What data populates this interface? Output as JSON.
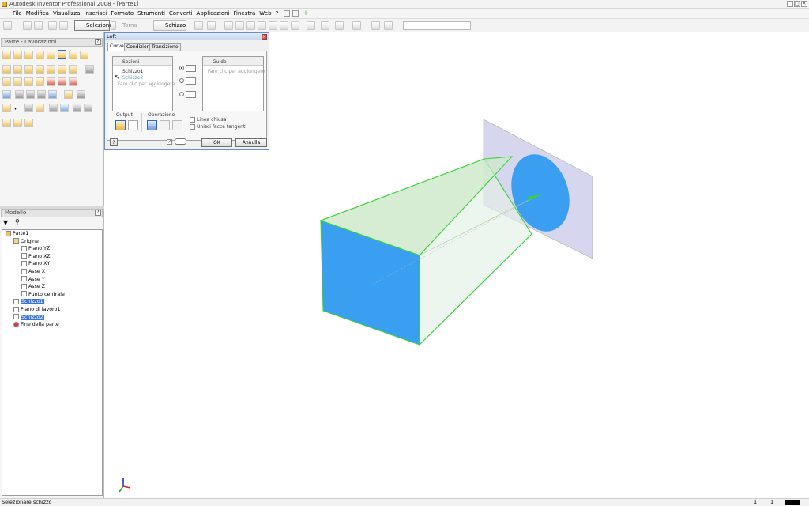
{
  "window": {
    "title": "Autodesk Inventor Professional 2008 - [Parte1]"
  },
  "menu": [
    "File",
    "Modifica",
    "Visualizza",
    "Inserisci",
    "Formato",
    "Strumenti",
    "Converti",
    "Applicazioni",
    "Finestra",
    "Web",
    "?"
  ],
  "toolbar": {
    "select_label": "Seleziona",
    "ritorna_label": "Torna",
    "sketch_label": "Schizzo"
  },
  "panel": {
    "title": "Parte - Lavorazioni"
  },
  "browser": {
    "title": "Modello",
    "tree": [
      {
        "label": "Parte1",
        "icon": "part-icon",
        "level": 0
      },
      {
        "label": "Origine",
        "icon": "folder-icon",
        "level": 1
      },
      {
        "label": "Piano YZ",
        "icon": "plane-icon",
        "level": 2
      },
      {
        "label": "Piano XZ",
        "icon": "plane-icon",
        "level": 2
      },
      {
        "label": "Piano XY",
        "icon": "plane-icon",
        "level": 2
      },
      {
        "label": "Asse X",
        "icon": "axis-icon",
        "level": 2
      },
      {
        "label": "Asse Y",
        "icon": "axis-icon",
        "level": 2
      },
      {
        "label": "Asse Z",
        "icon": "axis-icon",
        "level": 2
      },
      {
        "label": "Punto centrale",
        "icon": "point-icon",
        "level": 2
      },
      {
        "label": "Schizzo1",
        "icon": "sketch-icon",
        "level": 1,
        "selected": true
      },
      {
        "label": "Piano di lavoro1",
        "icon": "workplane-icon",
        "level": 1
      },
      {
        "label": "Schizzo2",
        "icon": "sketch-icon",
        "level": 1,
        "selected": true
      },
      {
        "label": "Fine della parte",
        "icon": "end-of-part-icon",
        "level": 1
      }
    ]
  },
  "dialog": {
    "title": "Loft",
    "tabs": [
      "Curve",
      "Condizioni",
      "Transizione"
    ],
    "sections_label": "Sezioni",
    "sections": [
      "Schizzo1",
      "Schizzo2",
      "Fare clic per aggiungere"
    ],
    "guides_label": "Guide",
    "guides_placeholder": "Fare clic per aggiungere",
    "output_label": "Output",
    "operation_label": "Operazione",
    "closed_loop": "Linea chiusa",
    "merge_tangent": "Unisci facce tangenti",
    "ok": "OK",
    "cancel": "Annulla",
    "help": "?"
  },
  "status": {
    "text": "Selezionare schizzo",
    "num1": "1",
    "num2": "1"
  },
  "colors": {
    "loft_face": "#3a9ff0",
    "edge": "#38d238",
    "plane": "#c8c8e8"
  }
}
